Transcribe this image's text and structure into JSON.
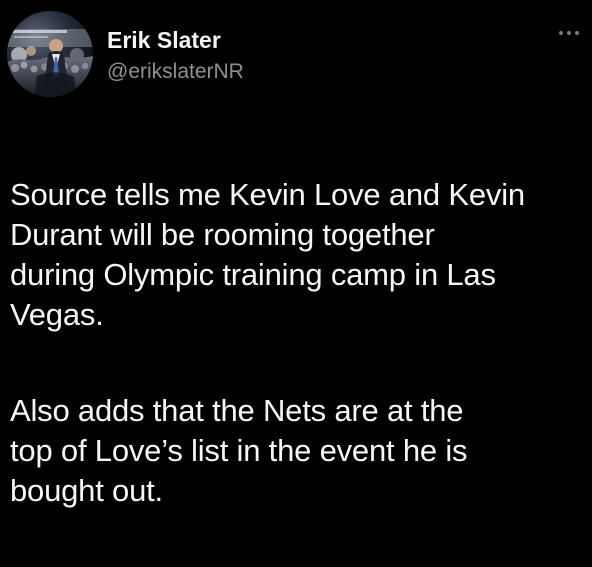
{
  "author": {
    "display_name": "Erik Slater",
    "handle": "@erikslaterNR",
    "avatar_icon": "profile-photo"
  },
  "menu": {
    "icon": "more-options-icon"
  },
  "tweet": {
    "paragraph_1": "Source tells me Kevin Love and Kevin\nDurant will be rooming together\nduring Olympic training camp in Las\nVegas.",
    "paragraph_2": "Also adds that the Nets are at the\ntop of Love’s list in the event he is\nbought out."
  },
  "colors": {
    "background": "#000000",
    "primary_text": "#f6f6f6",
    "secondary_text": "#8c9297",
    "menu_dots": "#767b80"
  }
}
